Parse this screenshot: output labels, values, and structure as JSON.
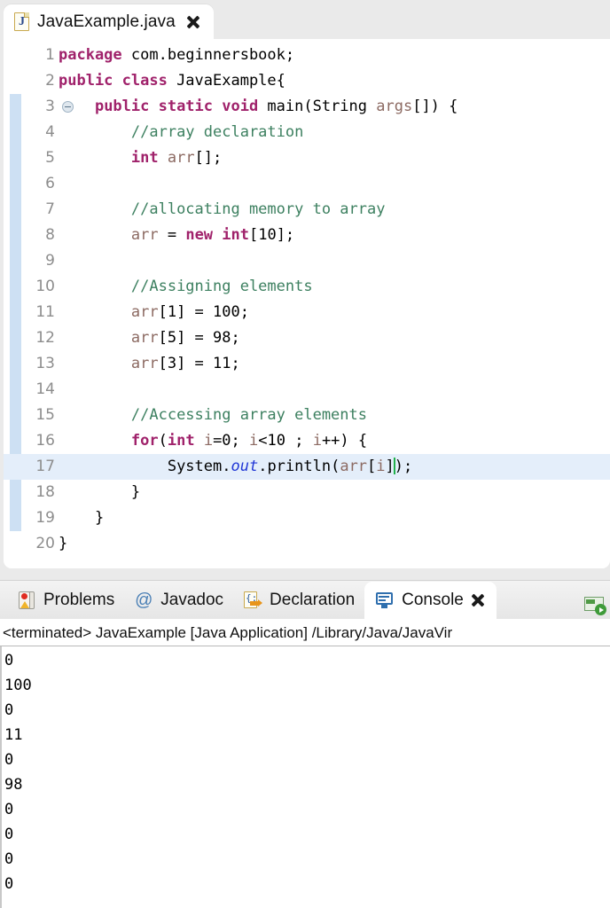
{
  "editor": {
    "tab": {
      "title": "JavaExample.java",
      "file_icon": "java-file-icon",
      "close_icon": "close-icon"
    },
    "fold_marker_line": 3,
    "current_line": 17,
    "colors": {
      "keyword": "#a0226b",
      "comment": "#3d8060",
      "local_variable": "#8c6a62",
      "static_field": "#2137d6",
      "current_line_bg": "#e4eefa",
      "fold_bar": "#bad4ee",
      "caret": "#22b14c"
    },
    "lines": [
      {
        "n": "1",
        "tokens": [
          {
            "t": "package ",
            "c": "kw"
          },
          {
            "t": "com.beginnersbook;",
            "c": "plain"
          }
        ]
      },
      {
        "n": "2",
        "tokens": [
          {
            "t": "public class ",
            "c": "kw"
          },
          {
            "t": "JavaExample{",
            "c": "plain"
          }
        ]
      },
      {
        "n": "3",
        "tokens": [
          {
            "t": "    ",
            "c": "plain"
          },
          {
            "t": "public static void ",
            "c": "kw"
          },
          {
            "t": "main(String ",
            "c": "plain"
          },
          {
            "t": "args",
            "c": "var"
          },
          {
            "t": "[]) {",
            "c": "plain"
          }
        ]
      },
      {
        "n": "4",
        "tokens": [
          {
            "t": "        ",
            "c": "plain"
          },
          {
            "t": "//array declaration",
            "c": "cmt"
          }
        ]
      },
      {
        "n": "5",
        "tokens": [
          {
            "t": "        ",
            "c": "plain"
          },
          {
            "t": "int ",
            "c": "kw"
          },
          {
            "t": "arr",
            "c": "var"
          },
          {
            "t": "[];",
            "c": "plain"
          }
        ]
      },
      {
        "n": "6",
        "tokens": [
          {
            "t": "",
            "c": "plain"
          }
        ]
      },
      {
        "n": "7",
        "tokens": [
          {
            "t": "        ",
            "c": "plain"
          },
          {
            "t": "//allocating memory to array",
            "c": "cmt"
          }
        ]
      },
      {
        "n": "8",
        "tokens": [
          {
            "t": "        ",
            "c": "plain"
          },
          {
            "t": "arr",
            "c": "var"
          },
          {
            "t": " = ",
            "c": "plain"
          },
          {
            "t": "new int",
            "c": "kw"
          },
          {
            "t": "[10];",
            "c": "plain"
          }
        ]
      },
      {
        "n": "9",
        "tokens": [
          {
            "t": "",
            "c": "plain"
          }
        ]
      },
      {
        "n": "10",
        "tokens": [
          {
            "t": "        ",
            "c": "plain"
          },
          {
            "t": "//Assigning elements",
            "c": "cmt"
          }
        ]
      },
      {
        "n": "11",
        "tokens": [
          {
            "t": "        ",
            "c": "plain"
          },
          {
            "t": "arr",
            "c": "var"
          },
          {
            "t": "[1] = 100;",
            "c": "plain"
          }
        ]
      },
      {
        "n": "12",
        "tokens": [
          {
            "t": "        ",
            "c": "plain"
          },
          {
            "t": "arr",
            "c": "var"
          },
          {
            "t": "[5] = 98;",
            "c": "plain"
          }
        ]
      },
      {
        "n": "13",
        "tokens": [
          {
            "t": "        ",
            "c": "plain"
          },
          {
            "t": "arr",
            "c": "var"
          },
          {
            "t": "[3] = 11;",
            "c": "plain"
          }
        ]
      },
      {
        "n": "14",
        "tokens": [
          {
            "t": "",
            "c": "plain"
          }
        ]
      },
      {
        "n": "15",
        "tokens": [
          {
            "t": "        ",
            "c": "plain"
          },
          {
            "t": "//Accessing array elements",
            "c": "cmt"
          }
        ]
      },
      {
        "n": "16",
        "tokens": [
          {
            "t": "        ",
            "c": "plain"
          },
          {
            "t": "for",
            "c": "kw"
          },
          {
            "t": "(",
            "c": "plain"
          },
          {
            "t": "int ",
            "c": "kw"
          },
          {
            "t": "i",
            "c": "var"
          },
          {
            "t": "=0; ",
            "c": "plain"
          },
          {
            "t": "i",
            "c": "var"
          },
          {
            "t": "<10 ; ",
            "c": "plain"
          },
          {
            "t": "i",
            "c": "var"
          },
          {
            "t": "++) {",
            "c": "plain"
          }
        ]
      },
      {
        "n": "17",
        "tokens": [
          {
            "t": "            ",
            "c": "plain"
          },
          {
            "t": "System.",
            "c": "plain"
          },
          {
            "t": "out",
            "c": "sfld"
          },
          {
            "t": ".println(",
            "c": "plain"
          },
          {
            "t": "arr",
            "c": "var"
          },
          {
            "t": "[",
            "c": "plain"
          },
          {
            "t": "i",
            "c": "var"
          },
          {
            "t": "]",
            "c": "plain"
          },
          {
            "t": "|caret|",
            "c": "caret"
          },
          {
            "t": ");",
            "c": "plain"
          }
        ]
      },
      {
        "n": "18",
        "tokens": [
          {
            "t": "        }",
            "c": "plain"
          }
        ]
      },
      {
        "n": "19",
        "tokens": [
          {
            "t": "    }",
            "c": "plain"
          }
        ]
      },
      {
        "n": "20",
        "tokens": [
          {
            "t": "}",
            "c": "plain"
          }
        ]
      }
    ]
  },
  "bottom_panel": {
    "tabs": [
      {
        "label": "Problems",
        "icon": "traffic-light-icon",
        "active": false,
        "closable": false
      },
      {
        "label": "Javadoc",
        "icon": "at-sign-icon",
        "active": false,
        "closable": false
      },
      {
        "label": "Declaration",
        "icon": "declaration-doc-icon",
        "active": false,
        "closable": false
      },
      {
        "label": "Console",
        "icon": "console-monitor-icon",
        "active": true,
        "closable": true
      }
    ],
    "toolbar": [
      {
        "icon": "display-selected-console-icon",
        "label": "Display Selected Console"
      }
    ],
    "console": {
      "status_line": "<terminated> JavaExample [Java Application] /Library/Java/JavaVir",
      "output": [
        "0",
        "100",
        "0",
        "11",
        "0",
        "98",
        "0",
        "0",
        "0",
        "0"
      ]
    }
  }
}
